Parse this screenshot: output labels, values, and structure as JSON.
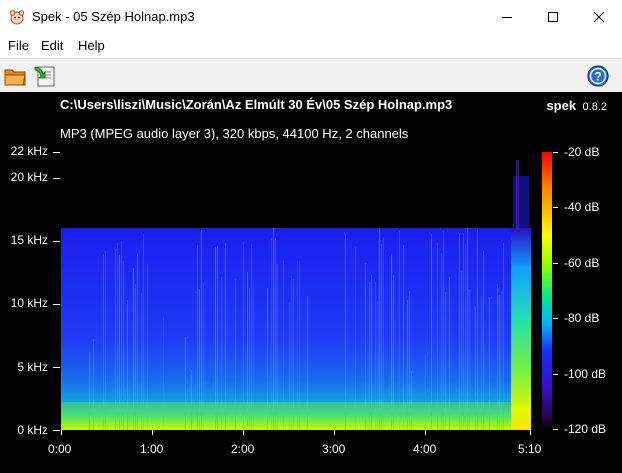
{
  "window": {
    "title": "Spek - 05 Szép Holnap.mp3",
    "icon": "spek-app-icon"
  },
  "menu": {
    "items": [
      {
        "label": "File"
      },
      {
        "label": "Edit"
      },
      {
        "label": "Help"
      }
    ]
  },
  "toolbar": {
    "open_icon": "folder-open-icon",
    "save_icon": "save-icon",
    "help_icon": "help-icon"
  },
  "viewer": {
    "file_path": "C:\\Users\\liszi\\Music\\Zorán\\Az Elmúlt 30 Év\\05 Szép Holnap.mp3",
    "file_info": "MP3 (MPEG audio layer 3), 320 kbps, 44100 Hz, 2 channels",
    "brand_name": "spek",
    "brand_version": "0.8.2"
  },
  "chart_data": {
    "type": "heatmap",
    "title": "",
    "xlabel": "",
    "ylabel": "",
    "x_ticks": [
      "0:00",
      "1:00",
      "2:00",
      "3:00",
      "4:00",
      "5:10"
    ],
    "y_ticks": [
      "0 kHz",
      "5 kHz",
      "10 kHz",
      "15 kHz",
      "20 kHz",
      "22 kHz"
    ],
    "xlim_seconds": [
      0,
      310
    ],
    "ylim_khz": [
      0,
      22.05
    ],
    "colorbar_ticks": [
      "-20 dB",
      "-40 dB",
      "-60 dB",
      "-80 dB",
      "-100 dB",
      "-120 dB"
    ],
    "colorbar_range_db": [
      -120,
      -20
    ],
    "lowpass_cutoff_khz": 16,
    "colors": {
      "loud": "#ffff00",
      "mid": "#00e0a0",
      "quiet": "#1a2bff",
      "background": "#000000"
    }
  }
}
